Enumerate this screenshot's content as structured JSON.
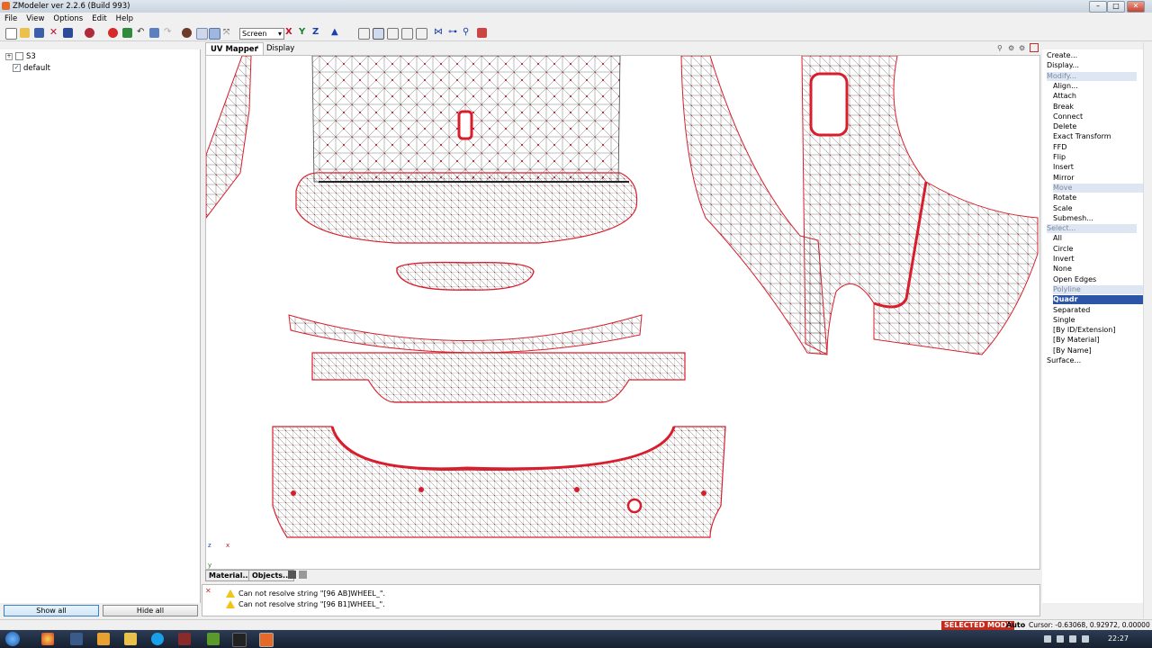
{
  "window": {
    "title": "ZModeler ver 2.2.6 (Build 993)",
    "controls": [
      "–",
      "□",
      "✕"
    ]
  },
  "menu": [
    "File",
    "View",
    "Options",
    "Edit",
    "Help"
  ],
  "toolbar": {
    "screen_mode": "Screen",
    "axes": [
      "X",
      "Y",
      "Z"
    ],
    "colors": {
      "x": "#c8102e",
      "y": "#1a7f2e",
      "z": "#1a3fb0"
    }
  },
  "scene_tree": [
    {
      "label": "S3",
      "checked": false,
      "expander": "+"
    },
    {
      "label": "default",
      "checked": true,
      "expander": ""
    }
  ],
  "left_buttons": {
    "show_all": "Show all",
    "hide_all": "Hide all"
  },
  "viewport": {
    "tabs": {
      "uv_mapper": "UV Mapper",
      "display": "Display"
    },
    "display_arrow": "‹",
    "axis_z": "z",
    "axis_x": "x",
    "axis_y": "y",
    "mesh_colors": {
      "vertex": "#d81e2c",
      "edge": "#3a3a3a",
      "background": "#ffffff"
    }
  },
  "bottom_tabs": {
    "material": "Material...",
    "objects": "Objects..."
  },
  "log": {
    "lines": [
      "Can not resolve string \"[96 AB]WHEEL_\".",
      "Can not resolve string \"[96 B1]WHEEL_\"."
    ]
  },
  "commands": [
    {
      "label": "Create...",
      "level": 0,
      "state": ""
    },
    {
      "label": "Display...",
      "level": 0,
      "state": ""
    },
    {
      "label": "Modify...",
      "level": 0,
      "state": "hdr-on"
    },
    {
      "label": "Align...",
      "level": 1,
      "state": ""
    },
    {
      "label": "Attach",
      "level": 1,
      "state": ""
    },
    {
      "label": "Break",
      "level": 1,
      "state": ""
    },
    {
      "label": "Connect",
      "level": 1,
      "state": ""
    },
    {
      "label": "Delete",
      "level": 1,
      "state": ""
    },
    {
      "label": "Exact Transform",
      "level": 1,
      "state": ""
    },
    {
      "label": "FFD",
      "level": 1,
      "state": ""
    },
    {
      "label": "Flip",
      "level": 1,
      "state": ""
    },
    {
      "label": "Insert",
      "level": 1,
      "state": ""
    },
    {
      "label": "Mirror",
      "level": 1,
      "state": ""
    },
    {
      "label": "Move",
      "level": 1,
      "state": "sel"
    },
    {
      "label": "Rotate",
      "level": 1,
      "state": ""
    },
    {
      "label": "Scale",
      "level": 1,
      "state": ""
    },
    {
      "label": "Submesh...",
      "level": 1,
      "state": ""
    },
    {
      "label": "Select...",
      "level": 0,
      "state": "hdr-on"
    },
    {
      "label": "All",
      "level": 1,
      "state": ""
    },
    {
      "label": "Circle",
      "level": 1,
      "state": ""
    },
    {
      "label": "Invert",
      "level": 1,
      "state": ""
    },
    {
      "label": "None",
      "level": 1,
      "state": ""
    },
    {
      "label": "Open Edges",
      "level": 1,
      "state": ""
    },
    {
      "label": "Polyline",
      "level": 1,
      "state": "sel"
    },
    {
      "label": "Quadr",
      "level": 1,
      "state": "quadr"
    },
    {
      "label": "Separated",
      "level": 1,
      "state": ""
    },
    {
      "label": "Single",
      "level": 1,
      "state": ""
    },
    {
      "label": "[By ID/Extension]",
      "level": 1,
      "state": ""
    },
    {
      "label": "[By Material]",
      "level": 1,
      "state": ""
    },
    {
      "label": "[By Name]",
      "level": 1,
      "state": ""
    },
    {
      "label": "Surface...",
      "level": 0,
      "state": ""
    }
  ],
  "status": {
    "mode": "SELECTED MODE",
    "auto": "Auto",
    "cursor": "Cursor: -0.63068, 0.92972, 0.00000"
  },
  "taskbar": {
    "clock": "22:27"
  }
}
